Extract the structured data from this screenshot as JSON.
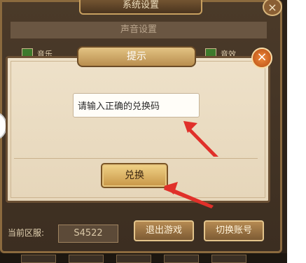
{
  "system_settings": {
    "title": "系统设置",
    "close_glyph": "×",
    "sound_section": "声音设置",
    "checkbox_1": "音乐",
    "checkbox_2": "音效",
    "server_label": "当前区服:",
    "server_value": "S4522",
    "exit_button": "退出游戏",
    "switch_account_button": "切换账号"
  },
  "dialog": {
    "title": "提示",
    "close_glyph": "×",
    "input_value": "请输入正确的兑换码",
    "redeem_button": "兑换"
  },
  "colors": {
    "annotation_arrow": "#e0302a",
    "dialog_bg": "#eadbc0",
    "panel_bg": "#44352a"
  }
}
